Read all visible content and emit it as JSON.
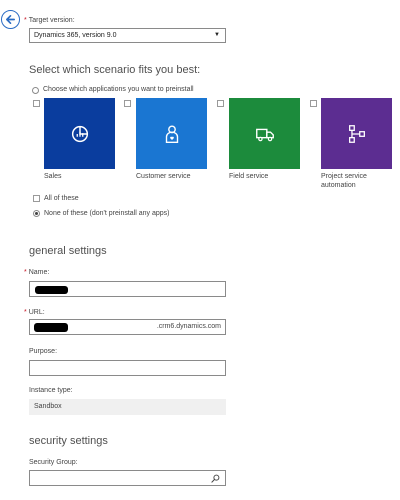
{
  "target": {
    "label": "Target version:",
    "selected": "Dynamics 365, version 9.0"
  },
  "scenario": {
    "heading": "Select which scenario fits you best:",
    "choose_label": "Choose which applications you want to preinstall",
    "apps": [
      {
        "label": "Sales",
        "color": "#0a3d9e",
        "icon": "chart-icon"
      },
      {
        "label": "Customer service",
        "color": "#1a76d2",
        "icon": "person-heart-icon"
      },
      {
        "label": "Field service",
        "color": "#1c8b3c",
        "icon": "truck-icon"
      },
      {
        "label": "Project service automation",
        "color": "#5c2d91",
        "icon": "hierarchy-icon"
      }
    ],
    "all_label": "All of these",
    "none_label": "None of these (don't preinstall any apps)"
  },
  "general": {
    "heading": "general settings",
    "name_label": "Name:",
    "url_label": "URL:",
    "url_suffix": ".crm6.dynamics.com",
    "purpose_label": "Purpose:",
    "instance_label": "Instance type:",
    "instance_value": "Sandbox"
  },
  "security": {
    "heading": "security settings",
    "group_label": "Security Group:"
  },
  "colors": {
    "accent": "#2b6cc4",
    "required": "#c50f1f"
  }
}
